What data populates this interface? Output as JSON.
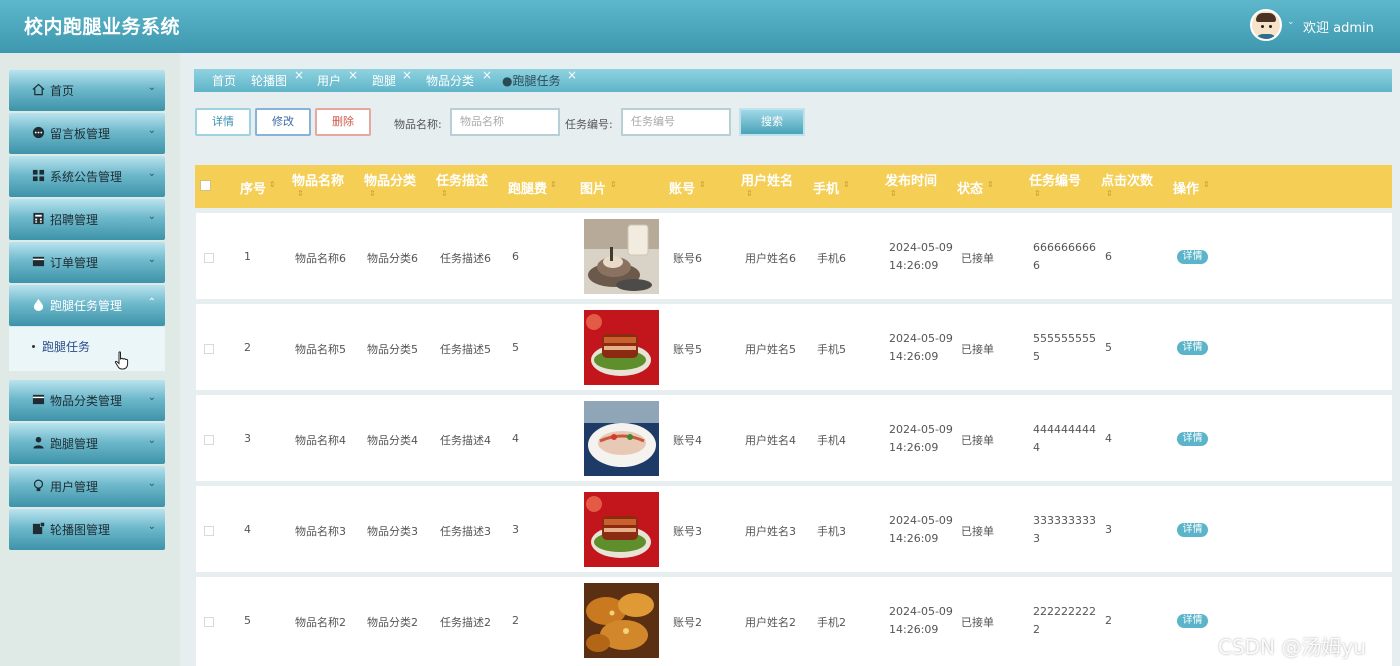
{
  "header": {
    "app_title": "校内跑腿业务系统",
    "welcome": "欢迎 admin",
    "user_caret": "⌄"
  },
  "sidebar": {
    "items": [
      {
        "label": "首页",
        "icon": "home-icon",
        "caret": "⌄"
      },
      {
        "label": "留言板管理",
        "icon": "message-icon",
        "caret": "⌄"
      },
      {
        "label": "系统公告管理",
        "icon": "grid-icon",
        "caret": "⌄"
      },
      {
        "label": "招聘管理",
        "icon": "calculator-icon",
        "caret": "⌄"
      },
      {
        "label": "订单管理",
        "icon": "card-icon",
        "caret": "⌄"
      },
      {
        "label": "跑腿任务管理",
        "icon": "drop-icon",
        "caret": "⌃"
      },
      {
        "label": "物品分类管理",
        "icon": "card-icon",
        "caret": "⌄"
      },
      {
        "label": "跑腿管理",
        "icon": "person-icon",
        "caret": "⌄"
      },
      {
        "label": "用户管理",
        "icon": "bulb-icon",
        "caret": "⌄"
      },
      {
        "label": "轮播图管理",
        "icon": "image-icon",
        "caret": "⌄"
      }
    ],
    "submenu": {
      "label": "跑腿任务"
    }
  },
  "tabs": [
    {
      "label": "首页",
      "closable": false
    },
    {
      "label": "轮播图",
      "closable": true
    },
    {
      "label": "用户",
      "closable": true
    },
    {
      "label": "跑腿",
      "closable": true
    },
    {
      "label": "物品分类",
      "closable": true
    },
    {
      "label": "●跑腿任务",
      "closable": true,
      "active": true
    }
  ],
  "tab_close_glyph": "×",
  "toolbar": {
    "detail": "详情",
    "edit": "修改",
    "delete": "删除",
    "item_name_label": "物品名称:",
    "item_name_placeholder": "物品名称",
    "task_no_label": "任务编号:",
    "task_no_placeholder": "任务编号",
    "search": "搜索"
  },
  "table": {
    "columns": [
      "序号",
      "物品名称",
      "物品分类",
      "任务描述",
      "跑腿费",
      "图片",
      "账号",
      "用户姓名",
      "手机",
      "发布时间",
      "状态",
      "任务编号",
      "点击次数",
      "操作"
    ],
    "sort_glyph": "⇕",
    "action_label": "详情",
    "rows": [
      {
        "idx": "1",
        "name": "物品名称6",
        "cat": "物品分类6",
        "desc": "任务描述6",
        "fee": "6",
        "account": "账号6",
        "user": "用户姓名6",
        "phone": "手机6",
        "date": "2024-05-09",
        "time": "14:26:09",
        "status": "已接单",
        "task_no_1": "666666666",
        "task_no_2": "6",
        "clicks": "6",
        "image": "tea-dessert"
      },
      {
        "idx": "2",
        "name": "物品名称5",
        "cat": "物品分类5",
        "desc": "任务描述5",
        "fee": "5",
        "account": "账号5",
        "user": "用户姓名5",
        "phone": "手机5",
        "date": "2024-05-09",
        "time": "14:26:09",
        "status": "已接单",
        "task_no_1": "555555555",
        "task_no_2": "5",
        "clicks": "5",
        "image": "braised-pork"
      },
      {
        "idx": "3",
        "name": "物品名称4",
        "cat": "物品分类4",
        "desc": "任务描述4",
        "fee": "4",
        "account": "账号4",
        "user": "用户姓名4",
        "phone": "手机4",
        "date": "2024-05-09",
        "time": "14:26:09",
        "status": "已接单",
        "task_no_1": "444444444",
        "task_no_2": "4",
        "clicks": "4",
        "image": "sliced-meat"
      },
      {
        "idx": "4",
        "name": "物品名称3",
        "cat": "物品分类3",
        "desc": "任务描述3",
        "fee": "3",
        "account": "账号3",
        "user": "用户姓名3",
        "phone": "手机3",
        "date": "2024-05-09",
        "time": "14:26:09",
        "status": "已接单",
        "task_no_1": "333333333",
        "task_no_2": "3",
        "clicks": "3",
        "image": "braised-pork"
      },
      {
        "idx": "5",
        "name": "物品名称2",
        "cat": "物品分类2",
        "desc": "任务描述2",
        "fee": "2",
        "account": "账号2",
        "user": "用户姓名2",
        "phone": "手机2",
        "date": "2024-05-09",
        "time": "14:26:09",
        "status": "已接单",
        "task_no_1": "222222222",
        "task_no_2": "2",
        "clicks": "2",
        "image": "fried-chicken"
      }
    ]
  },
  "watermark": "CSDN @汤姆yu"
}
